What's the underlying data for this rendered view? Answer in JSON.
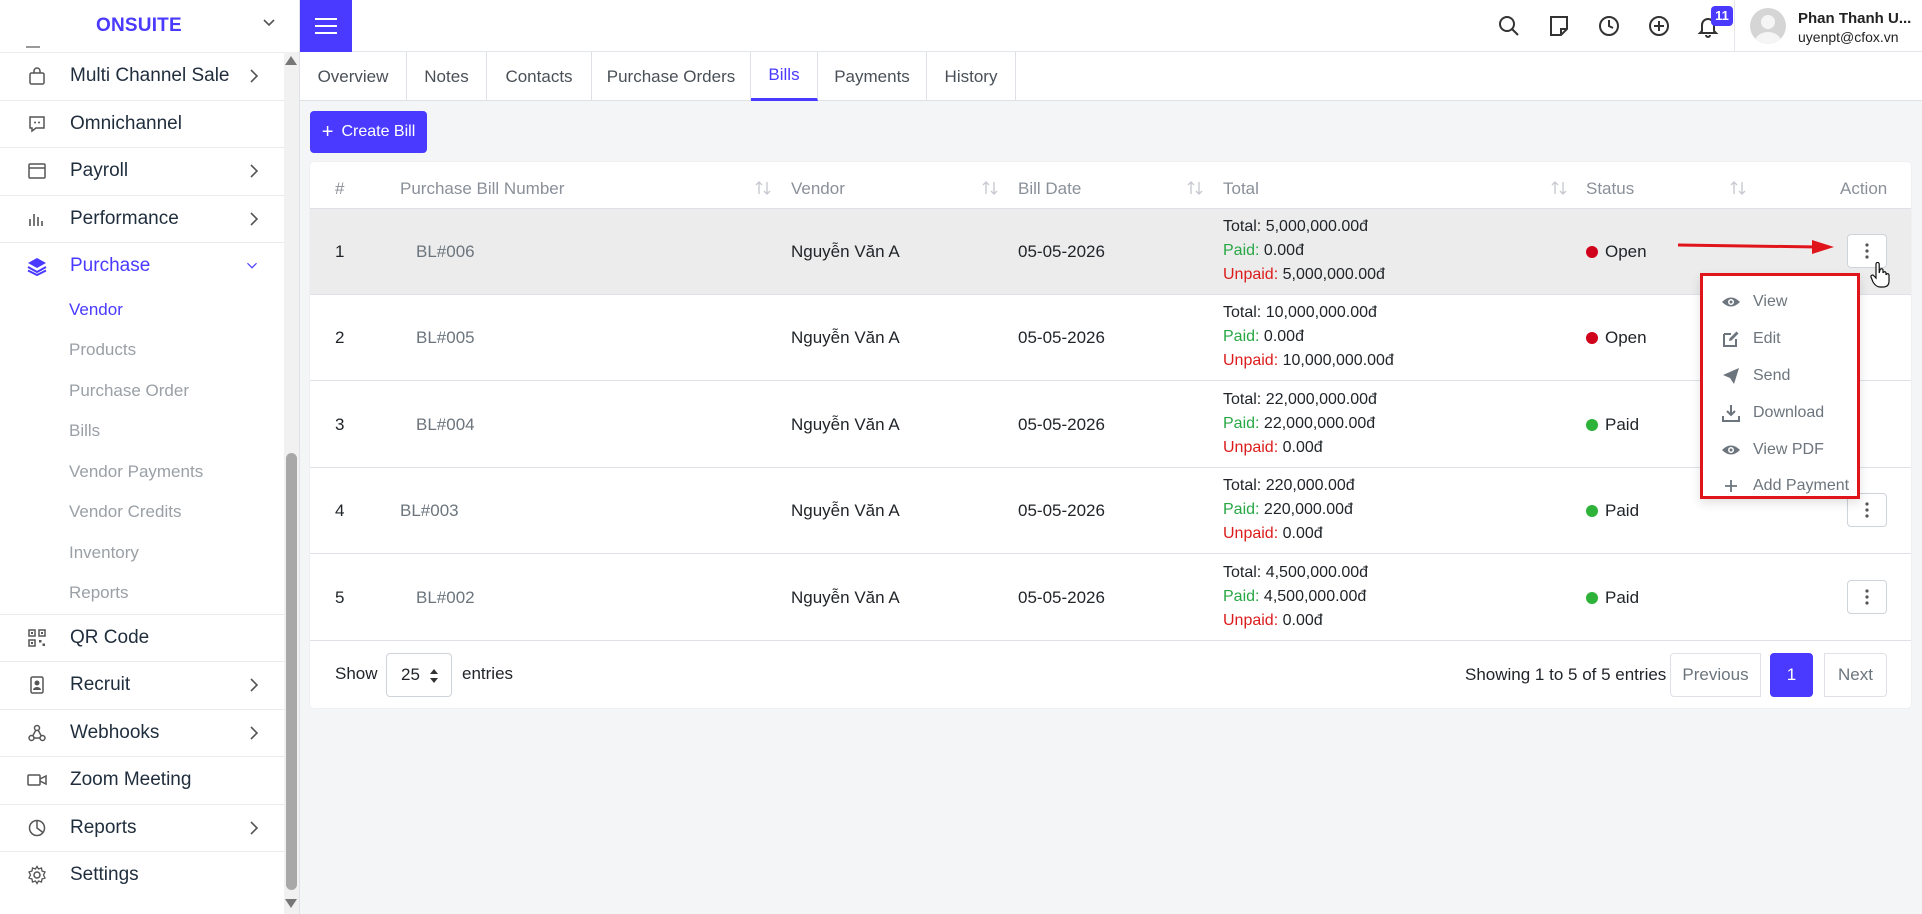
{
  "brand": {
    "name": "ONSUITE"
  },
  "sidebar": {
    "items": [
      {
        "label": "Multi Channel Sale",
        "icon": "bag-icon",
        "has_chevron": true
      },
      {
        "label": "Omnichannel",
        "icon": "chat-icon",
        "has_chevron": false
      },
      {
        "label": "Payroll",
        "icon": "window-icon",
        "has_chevron": true
      },
      {
        "label": "Performance",
        "icon": "bar-chart-icon",
        "has_chevron": true
      },
      {
        "label": "Purchase",
        "icon": "layers-icon",
        "has_chevron": true,
        "expanded": true
      }
    ],
    "purchase_sub": [
      "Vendor",
      "Products",
      "Purchase Order",
      "Bills",
      "Vendor Payments",
      "Vendor Credits",
      "Inventory",
      "Reports"
    ],
    "items_after": [
      {
        "label": "QR Code",
        "icon": "qr-code-icon",
        "has_chevron": false
      },
      {
        "label": "Recruit",
        "icon": "id-badge-icon",
        "has_chevron": true
      },
      {
        "label": "Webhooks",
        "icon": "webhooks-icon",
        "has_chevron": true
      },
      {
        "label": "Zoom Meeting",
        "icon": "video-icon",
        "has_chevron": false
      },
      {
        "label": "Reports",
        "icon": "pie-chart-icon",
        "has_chevron": true
      },
      {
        "label": "Settings",
        "icon": "gear-icon",
        "has_chevron": false
      }
    ]
  },
  "topbar": {
    "notification_count": "11",
    "user_name": "Phan Thanh U...",
    "user_email": "uyenpt@cfox.vn"
  },
  "tabs": [
    "Overview",
    "Notes",
    "Contacts",
    "Purchase Orders",
    "Bills",
    "Payments",
    "History"
  ],
  "active_tab": "Bills",
  "create_button": "Create Bill",
  "table": {
    "headers": [
      "#",
      "Purchase Bill Number",
      "Vendor",
      "Bill Date",
      "Total",
      "Status",
      "Action"
    ],
    "rows": [
      {
        "num": "1",
        "bill": "BL#006",
        "vendor": "Nguyễn Văn A",
        "date": "05-05-2026",
        "total": "5,000,000.00đ",
        "paid": "0.00đ",
        "unpaid": "5,000,000.00đ",
        "status": "Open"
      },
      {
        "num": "2",
        "bill": "BL#005",
        "vendor": "Nguyễn Văn A",
        "date": "05-05-2026",
        "total": "10,000,000.00đ",
        "paid": "0.00đ",
        "unpaid": "10,000,000.00đ",
        "status": "Open"
      },
      {
        "num": "3",
        "bill": "BL#004",
        "vendor": "Nguyễn Văn A",
        "date": "05-05-2026",
        "total": "22,000,000.00đ",
        "paid": "22,000,000.00đ",
        "unpaid": "0.00đ",
        "status": "Paid"
      },
      {
        "num": "4",
        "bill": "BL#003",
        "vendor": "Nguyễn Văn A",
        "date": "05-05-2026",
        "total": "220,000.00đ",
        "paid": "220,000.00đ",
        "unpaid": "0.00đ",
        "status": "Paid"
      },
      {
        "num": "5",
        "bill": "BL#002",
        "vendor": "Nguyễn Văn A",
        "date": "05-05-2026",
        "total": "4,500,000.00đ",
        "paid": "4,500,000.00đ",
        "unpaid": "0.00đ",
        "status": "Paid"
      }
    ],
    "total_label": "Total:",
    "paid_label": "Paid:",
    "unpaid_label": "Unpaid:"
  },
  "status_colors": {
    "Open": "#d0021b",
    "Paid": "#2db23a"
  },
  "action_menu": [
    "View",
    "Edit",
    "Send",
    "Download",
    "View PDF",
    "Add Payment"
  ],
  "footer": {
    "show_label": "Show",
    "page_length": "25",
    "entries_label": "entries",
    "info": "Showing 1 to 5 of 5 entries",
    "prev": "Previous",
    "page": "1",
    "next": "Next"
  },
  "colors": {
    "accent": "#4a3aff",
    "highlight": "#e0151b"
  }
}
